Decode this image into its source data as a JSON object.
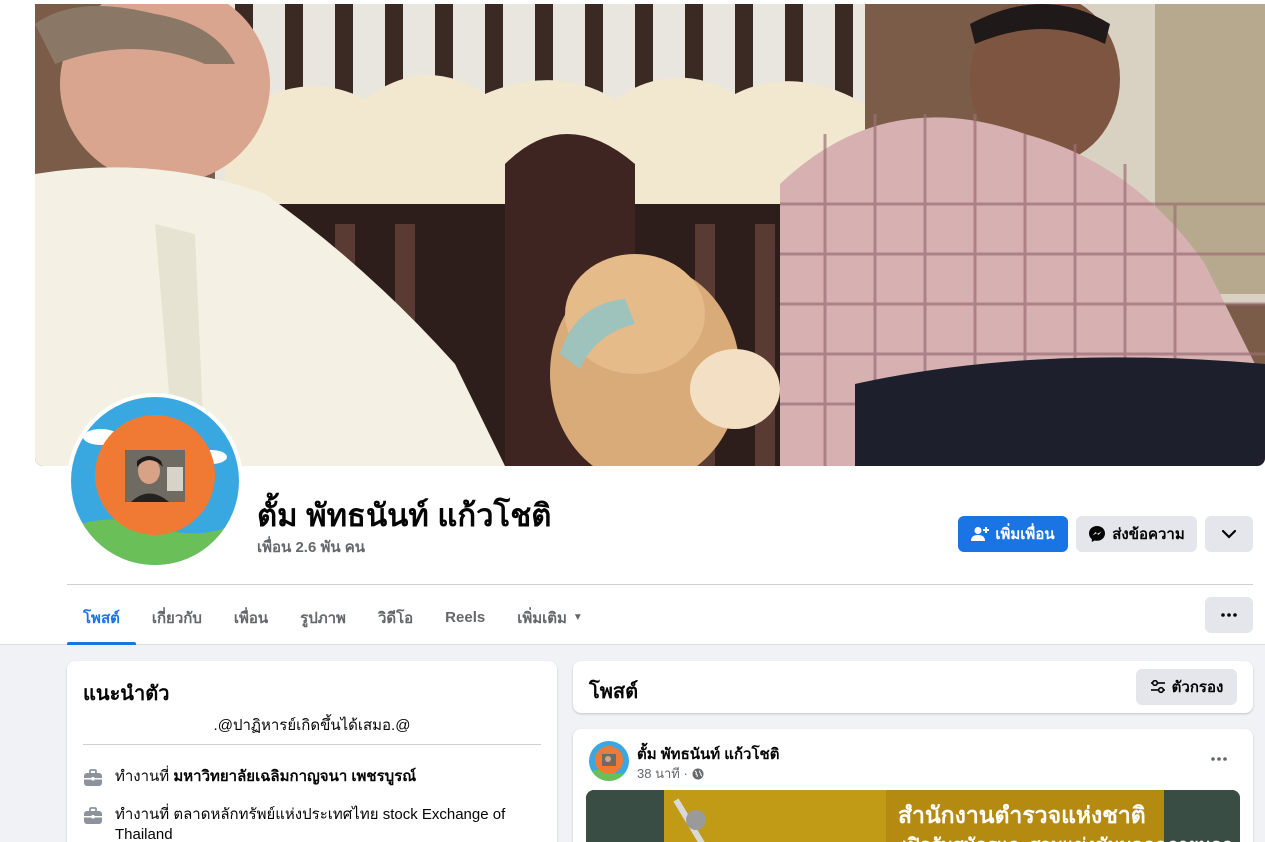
{
  "profile": {
    "name": "ตั้ม พัทธนันท์ แก้วโชติ",
    "friends": "เพื่อน 2.6 พัน คน"
  },
  "actions": {
    "add_friend": "เพิ่มเพื่อน",
    "message": "ส่งข้อความ"
  },
  "tabs": [
    {
      "label": "โพสต์"
    },
    {
      "label": "เกี่ยวกับ"
    },
    {
      "label": "เพื่อน"
    },
    {
      "label": "รูปภาพ"
    },
    {
      "label": "วิดีโอ"
    },
    {
      "label": "Reels"
    },
    {
      "label": "เพิ่มเติม"
    }
  ],
  "intro": {
    "title": "แนะนำตัว",
    "bio": ".@ปาฏิหารย์เกิดขึ้นได้เสมอ.@",
    "work": [
      {
        "prefix": "ทำงานที่",
        "place": "มหาวิทยาลัยเฉลิมกาญจนา เพชรบูรณ์",
        "icon": "briefcase-icon"
      },
      {
        "prefix": "ทำงานที่",
        "place": "ตลาดหลักทรัพย์แห่งประเทศไทย stock Exchange of Thailand",
        "icon": "briefcase-icon"
      }
    ]
  },
  "posts": {
    "title": "โพสต์",
    "filter_label": "ตัวกรอง",
    "items": [
      {
        "author": "ตั้ม พัทธนันท์ แก้วโชติ",
        "time": "38 นาที ·",
        "image_title": "สำนักงานตำรวจแห่งชาติ",
        "image_subtitle": "เปิดรับสมัครและสอบแข่งขันบุคคลภายนอก"
      }
    ]
  },
  "colors": {
    "primary": "#1b74e4",
    "secondary_bg": "#e4e6eb",
    "page_bg": "#f0f2f5",
    "muted_text": "#65676b"
  }
}
